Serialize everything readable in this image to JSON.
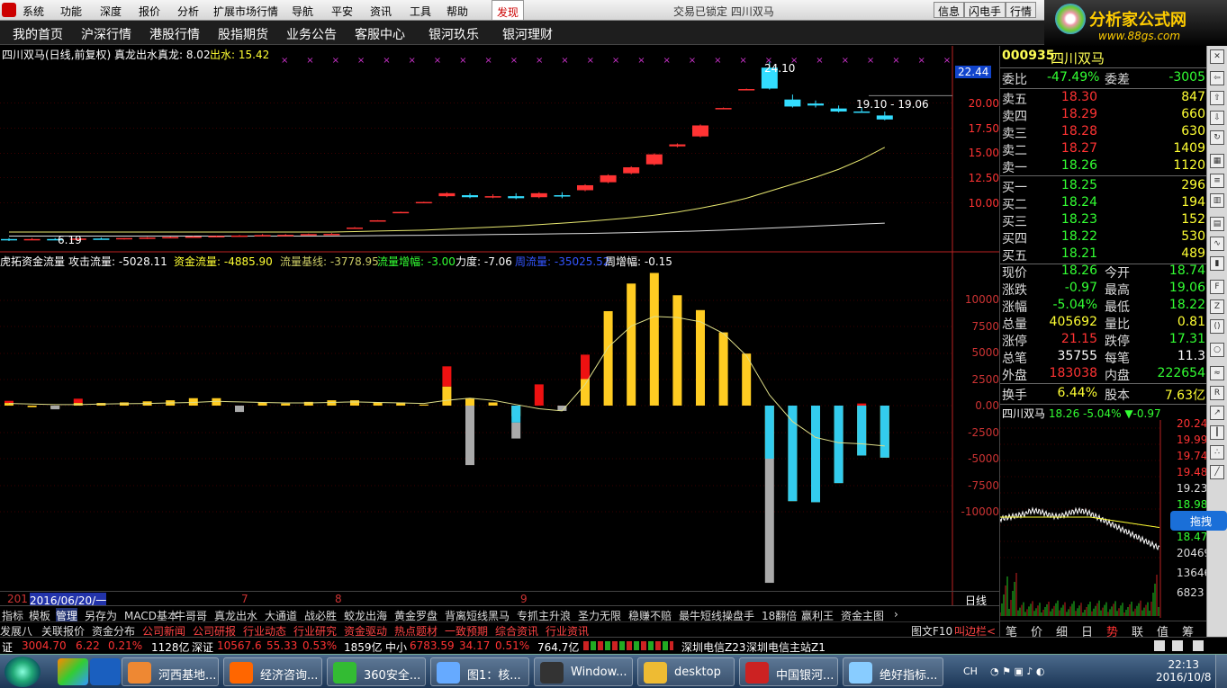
{
  "menu": {
    "items": [
      "系统",
      "功能",
      "深度",
      "报价",
      "分析",
      "扩展市场行情",
      "导航",
      "平安",
      "资讯",
      "工具",
      "帮助",
      "发现"
    ],
    "window_title": "交易已锁定    四川双马",
    "right_buttons": [
      "信息",
      "闪电手",
      "行情"
    ]
  },
  "brand": {
    "title": "分析家公式网",
    "url": "www.88gs.com"
  },
  "nav": {
    "items": [
      "我的首页",
      "沪深行情",
      "港股行情",
      "股指期货",
      "业务公告",
      "客服中心",
      "银河玖乐",
      "银河理财"
    ]
  },
  "kline": {
    "header_title": "四川双马(日线,前复权) 真龙出水",
    "header_zhenlong": "真龙: 8.02",
    "header_chushui": "出水: 15.42",
    "yticks": [
      "20.00",
      "17.50",
      "15.00",
      "12.50",
      "10.00"
    ],
    "current_price_tag": "22.44",
    "high_label": "24.10",
    "range_label": "19.10 - 19.06",
    "low_label": "6.19",
    "colors": {
      "up": "#ff3333",
      "down": "#33ddff",
      "ma1": "#e8e870",
      "ma2": "#dddddd",
      "marker": "#cc33cc"
    },
    "candles": [
      {
        "o": 6.3,
        "h": 6.4,
        "c": 6.2,
        "l": 6.1
      },
      {
        "o": 6.2,
        "h": 6.4,
        "c": 6.3,
        "l": 6.19
      },
      {
        "o": 6.3,
        "h": 6.4,
        "c": 6.25,
        "l": 6.2
      },
      {
        "o": 6.25,
        "h": 6.4,
        "c": 6.35,
        "l": 6.2
      },
      {
        "o": 6.35,
        "h": 6.45,
        "c": 6.3,
        "l": 6.25
      },
      {
        "o": 6.3,
        "h": 6.4,
        "c": 6.4,
        "l": 6.25
      },
      {
        "o": 6.4,
        "h": 6.5,
        "c": 6.45,
        "l": 6.3
      },
      {
        "o": 6.45,
        "h": 6.55,
        "c": 6.5,
        "l": 6.4
      },
      {
        "o": 6.5,
        "h": 6.6,
        "c": 6.55,
        "l": 6.45
      },
      {
        "o": 6.55,
        "h": 6.65,
        "c": 6.6,
        "l": 6.5
      },
      {
        "o": 6.6,
        "h": 6.7,
        "c": 6.65,
        "l": 6.55
      },
      {
        "o": 6.65,
        "h": 6.8,
        "c": 6.7,
        "l": 6.6
      },
      {
        "o": 6.7,
        "h": 6.8,
        "c": 6.72,
        "l": 6.65
      },
      {
        "o": 6.72,
        "h": 6.85,
        "c": 6.8,
        "l": 6.7
      },
      {
        "o": 6.8,
        "h": 6.9,
        "c": 6.82,
        "l": 6.75
      },
      {
        "o": 7.4,
        "h": 7.5,
        "c": 7.45,
        "l": 7.4
      },
      {
        "o": 8.1,
        "h": 8.2,
        "c": 8.18,
        "l": 8.1
      },
      {
        "o": 9.0,
        "h": 9.05,
        "c": 9.02,
        "l": 9.0
      },
      {
        "o": 10.0,
        "h": 10.05,
        "c": 10.02,
        "l": 10.0
      },
      {
        "o": 10.6,
        "h": 11.0,
        "c": 10.9,
        "l": 10.5
      },
      {
        "o": 10.7,
        "h": 10.9,
        "c": 10.5,
        "l": 10.4
      },
      {
        "o": 10.5,
        "h": 10.8,
        "c": 10.6,
        "l": 10.4
      },
      {
        "o": 10.6,
        "h": 10.9,
        "c": 10.4,
        "l": 10.3
      },
      {
        "o": 10.5,
        "h": 11.0,
        "c": 10.9,
        "l": 10.4
      },
      {
        "o": 10.7,
        "h": 11.0,
        "c": 10.6,
        "l": 10.4
      },
      {
        "o": 11.2,
        "h": 11.8,
        "c": 11.7,
        "l": 11.1
      },
      {
        "o": 12.0,
        "h": 12.8,
        "c": 12.7,
        "l": 11.9
      },
      {
        "o": 12.9,
        "h": 13.6,
        "c": 13.5,
        "l": 12.8
      },
      {
        "o": 13.8,
        "h": 14.9,
        "c": 14.8,
        "l": 13.7
      },
      {
        "o": 15.6,
        "h": 15.9,
        "c": 15.8,
        "l": 15.5
      },
      {
        "o": 16.6,
        "h": 17.8,
        "c": 17.7,
        "l": 16.5
      },
      {
        "o": 19.4,
        "h": 19.5,
        "c": 19.45,
        "l": 19.4
      },
      {
        "o": 21.3,
        "h": 21.4,
        "c": 21.35,
        "l": 21.3
      },
      {
        "o": 23.5,
        "h": 24.1,
        "c": 21.4,
        "l": 21.3
      },
      {
        "o": 20.3,
        "h": 20.8,
        "c": 19.6,
        "l": 19.5
      },
      {
        "o": 19.9,
        "h": 20.2,
        "c": 19.7,
        "l": 19.5
      },
      {
        "o": 19.4,
        "h": 19.7,
        "c": 19.1,
        "l": 19.0
      },
      {
        "o": 19.1,
        "h": 19.5,
        "c": 19.06,
        "l": 19.0
      },
      {
        "o": 18.7,
        "h": 19.1,
        "c": 18.3,
        "l": 18.22
      }
    ],
    "ma_slow": [
      7.0,
      7.0,
      7.0,
      7.0,
      7.0,
      7.0,
      7.0,
      7.0,
      7.0,
      7.0,
      7.0,
      7.0,
      7.0,
      7.0,
      7.0,
      7.05,
      7.1,
      7.15,
      7.2,
      7.3,
      7.4,
      7.5,
      7.6,
      7.75,
      7.9,
      8.05,
      8.25,
      8.45,
      8.7,
      9.0,
      9.4,
      9.85,
      10.4,
      11.1,
      11.8,
      12.5,
      13.3,
      14.3,
      15.5
    ],
    "ma_fast": [
      6.6,
      6.6,
      6.6,
      6.6,
      6.6,
      6.6,
      6.6,
      6.6,
      6.6,
      6.6,
      6.6,
      6.6,
      6.6,
      6.6,
      6.6,
      6.62,
      6.64,
      6.66,
      6.68,
      6.7,
      6.72,
      6.75,
      6.78,
      6.8,
      6.83,
      6.86,
      6.9,
      6.95,
      7.0,
      7.05,
      7.12,
      7.2,
      7.3,
      7.4,
      7.5,
      7.6,
      7.7,
      7.8,
      7.9
    ]
  },
  "indicator": {
    "title": "虎拓资金流量",
    "items": [
      {
        "label": "攻击流量: -5028.11",
        "color": "#ffffff"
      },
      {
        "label": "资金流量: -4885.90",
        "color": "#ffff33"
      },
      {
        "label": "流量基线: -3778.95",
        "color": "#cccc66"
      },
      {
        "label": "流量增幅: -3.00",
        "color": "#33ff33"
      },
      {
        "label": "力度: -7.06",
        "color": "#ffffff"
      },
      {
        "label": "周流量: -35025.52",
        "color": "#3355ff"
      },
      {
        "label": "周增幅: -0.15",
        "color": "#ffffff"
      }
    ],
    "yticks": [
      "10000",
      "7500",
      "5000",
      "2500",
      "0.00",
      "-2500",
      "-5000",
      "-7500",
      "-10000"
    ],
    "bars": [
      {
        "y": 250,
        "r": 450
      },
      {
        "y": -150,
        "r": 0
      },
      {
        "y": -250,
        "g": -350
      },
      {
        "y": 250,
        "r": 650
      },
      {
        "y": 250,
        "r": 0
      },
      {
        "y": 300,
        "r": 0
      },
      {
        "y": 400,
        "r": 0
      },
      {
        "y": 500,
        "r": 0
      },
      {
        "y": 700,
        "r": 0
      },
      {
        "y": 700,
        "r": 0
      },
      {
        "y": -200,
        "g": -600
      },
      {
        "y": 300,
        "r": 0
      },
      {
        "y": 200,
        "r": 0
      },
      {
        "y": 350,
        "r": 0
      },
      {
        "y": 500,
        "r": 0
      },
      {
        "y": 500,
        "r": 0
      },
      {
        "y": 300,
        "r": 0
      },
      {
        "y": 300,
        "r": 0
      },
      {
        "y": 100,
        "r": 0
      },
      {
        "y": 1800,
        "r": 3700
      },
      {
        "y": 700,
        "g": -5600
      },
      {
        "y": 300,
        "r": 0
      },
      {
        "y": -1000,
        "c": -1600,
        "g": -3100
      },
      {
        "y": 0,
        "r": 2000
      },
      {
        "y": -100,
        "g": -500
      },
      {
        "y": 2500,
        "r": 4800
      },
      {
        "y": 8900,
        "r": 0
      },
      {
        "y": 11500,
        "r": 0
      },
      {
        "y": 12500,
        "r": 0
      },
      {
        "y": 10400,
        "r": 0
      },
      {
        "y": 9000,
        "r": 0
      },
      {
        "y": 6900,
        "r": 0
      },
      {
        "y": 4900,
        "r": 0
      },
      {
        "y": -5000,
        "c": -5000,
        "g": -16700
      },
      {
        "y": -9000,
        "c": -9000
      },
      {
        "y": -9100,
        "c": -9100
      },
      {
        "y": -7300,
        "c": -7300
      },
      {
        "y": -4700,
        "c": -4700,
        "r2": 200
      },
      {
        "y": -4900,
        "c": -4900
      }
    ],
    "line": [
      200,
      150,
      100,
      100,
      150,
      180,
      200,
      250,
      300,
      400,
      350,
      300,
      250,
      250,
      300,
      350,
      300,
      250,
      200,
      500,
      700,
      500,
      100,
      -300,
      -500,
      2000,
      5500,
      7500,
      8400,
      8300,
      7900,
      6800,
      4700,
      1000,
      -1500,
      -3000,
      -3500,
      -3600,
      -3800
    ]
  },
  "timeaxis": {
    "labels": [
      "201",
      "2016/06/20/一",
      "7",
      "8",
      "9"
    ],
    "period": "日线"
  },
  "tabs1": [
    "指标",
    "模板",
    "管理",
    "另存为",
    "MACD基本",
    "牛哥哥",
    "真龙出水",
    "大通道",
    "战必胜",
    "蛟龙出海",
    "黄金罗盘",
    "背离短线黑马",
    "专抓主升浪",
    "圣力无限",
    "稳赚不赔",
    "最牛短线操盘手",
    "18翻倍",
    "赢利王",
    "资金主图"
  ],
  "tabs2": [
    "发展八",
    "关联报价",
    "资金分布",
    "公司新闻",
    "公司研报",
    "行业动态",
    "行业研究",
    "资金驱动",
    "热点题材",
    "一致预期",
    "综合资讯",
    "行业资讯"
  ],
  "tabs2_right": [
    "图文F10",
    "叫边栏<"
  ],
  "rp": {
    "code": "000935",
    "name": "四川双马",
    "weibi": {
      "label": "委比",
      "value": "-47.49%",
      "label2": "委差",
      "value2": "-3005"
    },
    "sells": [
      {
        "label": "卖五",
        "price": "18.30",
        "vol": "847"
      },
      {
        "label": "卖四",
        "price": "18.29",
        "vol": "660"
      },
      {
        "label": "卖三",
        "price": "18.28",
        "vol": "630"
      },
      {
        "label": "卖二",
        "price": "18.27",
        "vol": "1409"
      },
      {
        "label": "卖一",
        "price": "18.26",
        "vol": "1120"
      }
    ],
    "buys": [
      {
        "label": "买一",
        "price": "18.25",
        "vol": "296"
      },
      {
        "label": "买二",
        "price": "18.24",
        "vol": "194"
      },
      {
        "label": "买三",
        "price": "18.23",
        "vol": "152"
      },
      {
        "label": "买四",
        "price": "18.22",
        "vol": "530"
      },
      {
        "label": "买五",
        "price": "18.21",
        "vol": "489"
      }
    ],
    "quote": [
      {
        "l": "现价",
        "v": "18.26",
        "vc": "green",
        "l2": "今开",
        "v2": "18.74",
        "v2c": "green"
      },
      {
        "l": "涨跌",
        "v": "-0.97",
        "vc": "green",
        "l2": "最高",
        "v2": "19.06",
        "v2c": "green"
      },
      {
        "l": "涨幅",
        "v": "-5.04%",
        "vc": "green",
        "l2": "最低",
        "v2": "18.22",
        "v2c": "green"
      },
      {
        "l": "总量",
        "v": "405692",
        "vc": "yellow",
        "l2": "量比",
        "v2": "0.81",
        "v2c": "yellow"
      },
      {
        "l": "涨停",
        "v": "21.15",
        "vc": "red",
        "l2": "跌停",
        "v2": "17.31",
        "v2c": "green"
      },
      {
        "l": "总笔",
        "v": "35755",
        "vc": "white",
        "l2": "每笔",
        "v2": "11.3",
        "v2c": "white"
      },
      {
        "l": "外盘",
        "v": "183038",
        "vc": "red",
        "l2": "内盘",
        "v2": "222654",
        "v2c": "green"
      }
    ],
    "turnover": {
      "l": "换手",
      "v": "6.44%",
      "l2": "股本",
      "v2": "7.63亿"
    },
    "mini_header": {
      "name": "四川双马",
      "price": "18.26",
      "pct": "-5.04%",
      "chg": "▼-0.97"
    },
    "mini_ticks": [
      "20.24",
      "19.99",
      "19.74",
      "19.48",
      "19.23",
      "18.98",
      "18.72",
      "18.47",
      "20469",
      "13646",
      "6823"
    ],
    "tabs": [
      "笔",
      "价",
      "细",
      "日",
      "势",
      "联",
      "值",
      "筹"
    ]
  },
  "status": {
    "sh_label": "证",
    "sh_val": "3004.70",
    "sh_chg": "6.22",
    "sh_pct": "0.21%",
    "sh_amt": "1128亿",
    "sz_label": "深证",
    "sz_val": "10567.6",
    "sz_chg": "55.33",
    "sz_pct": "0.53%",
    "sz_amt": "1859亿",
    "zx_label": "中小",
    "zx_val": "6783.59",
    "zx_chg": "34.17",
    "zx_pct": "0.51%",
    "zx_amt": "764.7亿",
    "server1": "深圳电信Z23",
    "server2": "深圳电信主站Z1"
  },
  "taskbar": {
    "tasks": [
      "河西基地...",
      "经济咨询...",
      "360安全...",
      "图1：核...",
      "Window...",
      "desktop",
      "中国银河...",
      "绝好指标..."
    ],
    "lang": "CH",
    "time": "22:13",
    "date": "2016/10/8"
  },
  "sidebar_labels": [
    "拖拽"
  ]
}
